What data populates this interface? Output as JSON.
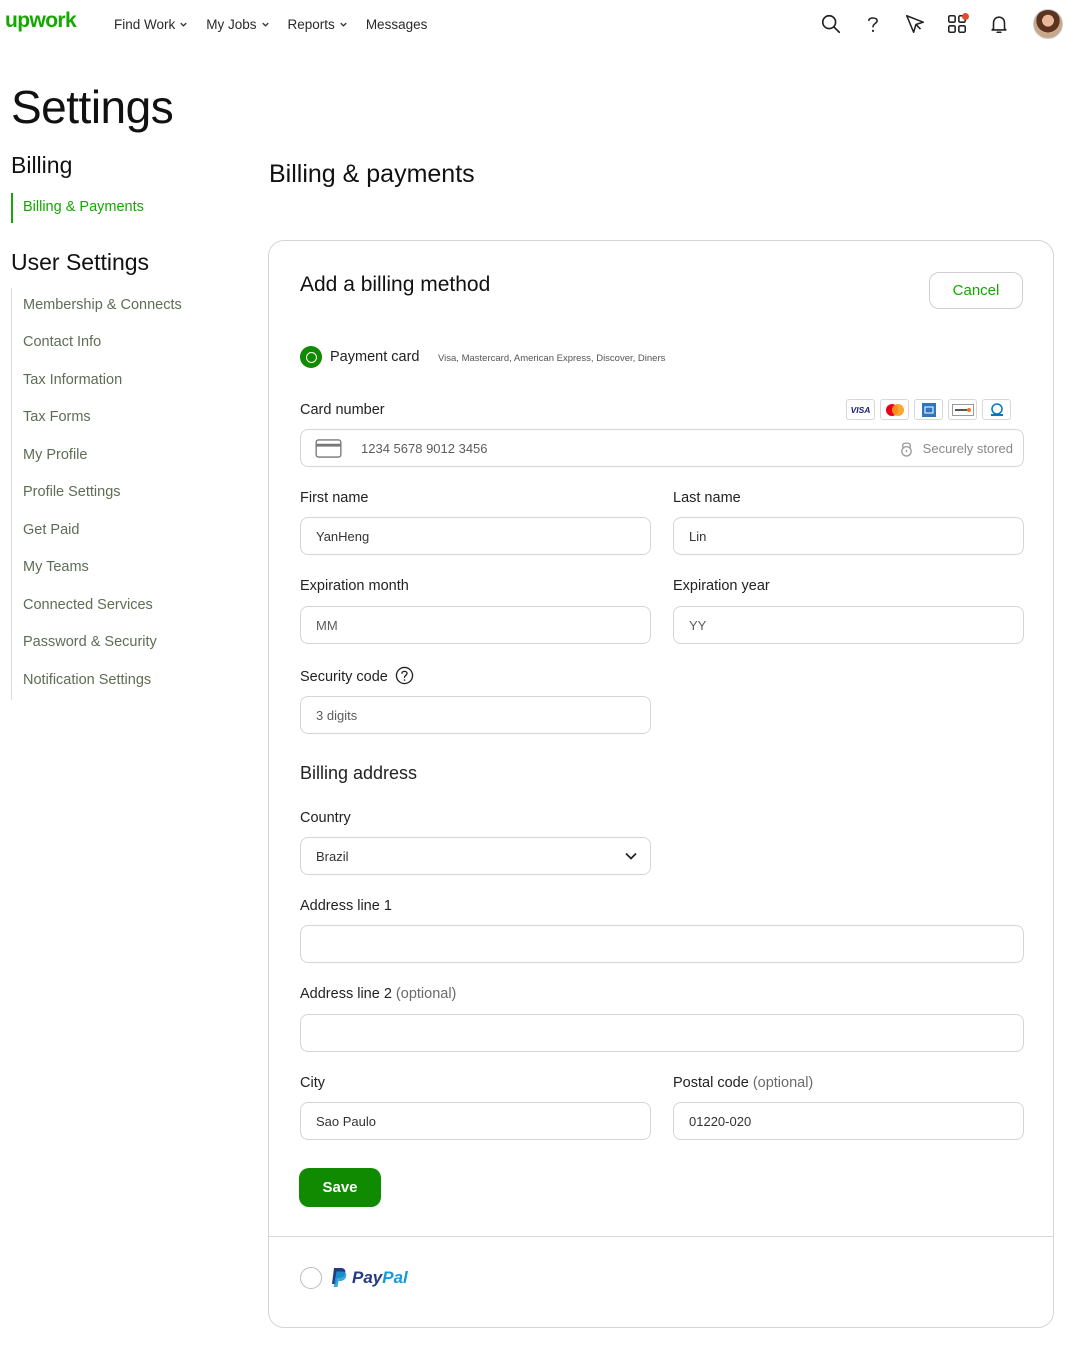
{
  "brand": {
    "logo_text": "upwork",
    "accent": "#14a800",
    "button_green": "#108a00"
  },
  "nav": {
    "links": [
      "Find Work",
      "My Jobs",
      "Reports",
      "Messages"
    ],
    "icons": [
      "search-icon",
      "help-icon",
      "send-icon",
      "apps-icon",
      "bell-icon",
      "avatar"
    ]
  },
  "page": {
    "title": "Settings"
  },
  "sidebar": {
    "billing_heading": "Billing",
    "billing_items": [
      "Billing & Payments"
    ],
    "user_heading": "User Settings",
    "user_items": [
      "Membership & Connects",
      "Contact Info",
      "Tax Information",
      "Tax Forms",
      "My Profile",
      "Profile Settings",
      "Get Paid",
      "My Teams",
      "Connected Services",
      "Password & Security",
      "Notification Settings"
    ]
  },
  "main": {
    "title": "Billing & payments",
    "card": {
      "title": "Add a billing method",
      "cancel_label": "Cancel",
      "payment_card": {
        "label": "Payment card",
        "hint": "Visa, Mastercard, American Express, Discover, Diners",
        "selected": true
      },
      "card_logos": [
        "VISA",
        "mastercard",
        "amex",
        "discover",
        "diners"
      ],
      "card_number": {
        "label": "Card number",
        "placeholder": "1234 5678 9012 3456",
        "secure_text": "Securely stored"
      },
      "first_name": {
        "label": "First name",
        "value": "YanHeng"
      },
      "last_name": {
        "label": "Last name",
        "value": "Lin"
      },
      "exp_month": {
        "label": "Expiration month",
        "placeholder": "MM"
      },
      "exp_year": {
        "label": "Expiration year",
        "placeholder": "YY"
      },
      "security_code": {
        "label": "Security code",
        "placeholder": "3 digits"
      },
      "billing_address": {
        "heading": "Billing address",
        "country": {
          "label": "Country",
          "value": "Brazil"
        },
        "address1": {
          "label": "Address line 1",
          "value": ""
        },
        "address2": {
          "label": "Address line 2",
          "optional": "(optional)",
          "value": ""
        },
        "city": {
          "label": "City",
          "value": "Sao Paulo"
        },
        "postal": {
          "label": "Postal code",
          "optional": "(optional)",
          "value": "01220-020"
        }
      },
      "save_label": "Save",
      "paypal": {
        "word_a": "Pay",
        "word_b": "Pal",
        "selected": false
      }
    }
  }
}
